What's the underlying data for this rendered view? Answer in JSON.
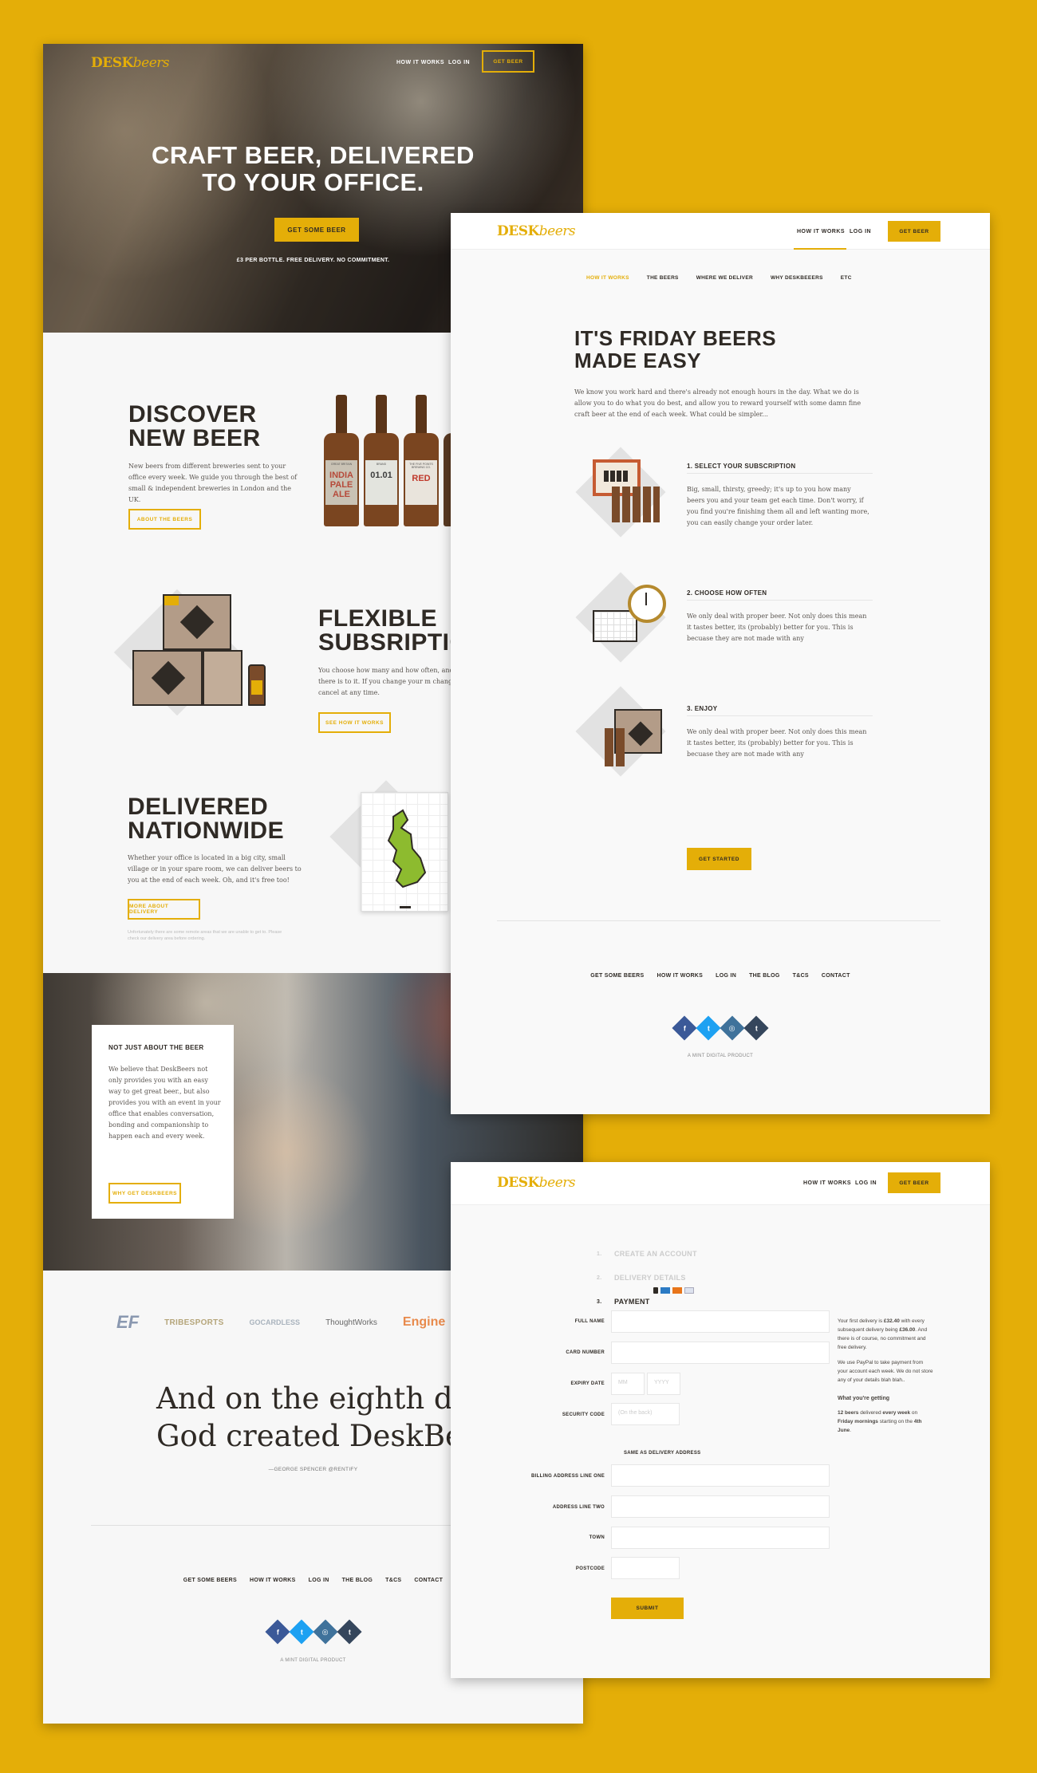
{
  "brand": {
    "logo_prefix": "DESK",
    "logo_suffix": "beers",
    "accent": "#e4ae08",
    "dark": "#2f2a25"
  },
  "landing": {
    "nav": {
      "how": "HOW IT WORKS",
      "login": "LOG IN",
      "cta": "GET BEER"
    },
    "hero": {
      "title_line1": "CRAFT BEER, DELIVERED",
      "title_line2": "TO YOUR OFFICE.",
      "cta": "GET SOME BEER",
      "note": "£3 PER BOTTLE. FREE DELIVERY. NO COMMITMENT."
    },
    "discover": {
      "title_line1": "DISCOVER",
      "title_line2": "NEW BEER",
      "body": "New beers from different breweries sent to your office every week. We guide you through the best of small & independent breweries in London and the UK.",
      "cta": "ABOUT THE BEERS"
    },
    "bottles": [
      {
        "label": "INDIA PALE ALE",
        "brand": "GREAT BRITAIN",
        "color": "#c9c2b4",
        "text": "#b64a3a"
      },
      {
        "label": "01.01",
        "brand": "BRAND",
        "color": "#e3e4de",
        "text": "#3d3d3d"
      },
      {
        "label": "RED",
        "brand": "THE FIVE POINTS BREWING CO.",
        "color": "#e9e4dc",
        "text": "#c0392b"
      }
    ],
    "flexible": {
      "title_line1": "FLEXIBLE",
      "title_line2": "SUBSRIPTIO",
      "body": "You choose how many and how often, and much all there is to it. If you change your m change, pause or cancel at any time.",
      "cta": "SEE HOW IT WORKS"
    },
    "delivered": {
      "title_line1": "DELIVERED",
      "title_line2": "NATIONWIDE",
      "body": "Whether your office is located in a big city, small village or in your spare room, we can deliver beers to you at the end of each week. Oh, and it's free too!",
      "cta": "MORE ABOUT DELIVERY",
      "fine": "Unfortunately there are some remote areas that we are unable to get to. Please check our delivery area before ordering."
    },
    "about": {
      "title": "NOT JUST ABOUT THE BEER",
      "body": "We believe that DeskBeers not only provides you with an easy way to get great beer., but also provides you with an event in your office that enables conversation, bonding and companionship to happen each and every week.",
      "cta": "WHY GET DESKBEERS"
    },
    "logos": [
      "EF",
      "TRIBESPORTS",
      "GOCARDLESS",
      "ThoughtWorks",
      "Engine"
    ],
    "quote": {
      "line1": "And on the eighth day",
      "line2": "God created DeskBeer",
      "author": "—GEORGE SPENCER @RENTIFY"
    },
    "footer": {
      "links": [
        "GET SOME BEERS",
        "HOW IT WORKS",
        "LOG IN",
        "THE BLOG",
        "T&CS",
        "CONTACT"
      ],
      "credit": "A MINT DIGITAL PRODUCT"
    }
  },
  "how": {
    "nav": {
      "how": "HOW IT WORKS",
      "login": "LOG IN",
      "cta": "GET BEER"
    },
    "tabs": [
      "HOW IT WORKS",
      "THE BEERS",
      "WHERE WE DELIVER",
      "WHY DESKBEEERS",
      "ETC"
    ],
    "title_line1": "IT'S FRIDAY BEERS",
    "title_line2": "MADE EASY",
    "intro": "We know you work hard and there's already not enough hours in the day. What we do is allow you to do what you do best, and allow you to reward yourself with some damn fine craft beer at the end of each week. What could be simpler...",
    "steps": [
      {
        "title": "1. SELECT YOUR SUBSCRIPTION",
        "body": "Big, small, thirsty, greedy; it's up to you how many beers you and your team get each time. Don't worry, if you find you're finishing them all and left wanting more, you can easily change your order later."
      },
      {
        "title": "2. CHOOSE HOW OFTEN",
        "body": "We only deal with proper beer. Not only does this mean it tastes better, its (probably) better for you. This is becuase they are not made with any"
      },
      {
        "title": "3. ENJOY",
        "body": "We only deal with proper beer. Not only does this mean it tastes better, its (probably) better for you. This is becuase they are not made with any"
      }
    ],
    "cta": "GET STARTED",
    "footer": {
      "links": [
        "GET SOME BEERS",
        "HOW IT WORKS",
        "LOG IN",
        "THE BLOG",
        "T&CS",
        "CONTACT"
      ],
      "credit": "A MINT DIGITAL PRODUCT"
    }
  },
  "checkout": {
    "nav": {
      "how": "HOW IT WORKS",
      "login": "LOG IN",
      "cta": "GET BEER"
    },
    "steps": [
      {
        "num": "1.",
        "label": "CREATE AN ACCOUNT"
      },
      {
        "num": "2.",
        "label": "DELIVERY DETAILS"
      },
      {
        "num": "3.",
        "label": "PAYMENT"
      }
    ],
    "fields": {
      "full_name": "FULL NAME",
      "card_number": "CARD NUMBER",
      "expiry": "EXPIRY DATE",
      "mm": "MM",
      "yyyy": "YYYY",
      "security": "SECURITY CODE",
      "security_ph": "(On the back)",
      "same_addr": "SAME AS DELIVERY ADDRESS",
      "billing1": "BILLING ADDRESS LINE ONE",
      "line2": "ADDRESS LINE TWO",
      "town": "TOWN",
      "postcode": "POSTCODE",
      "submit": "SUBMIT"
    },
    "side": {
      "p1_a": "Your first delivery is ",
      "p1_b": "£32.40",
      "p1_c": " with every subsequent delivery being ",
      "p1_d": "£36.00",
      "p1_e": ". And there is of course, no commitment and free delivery.",
      "p2": "We use PayPal to take payment from your account each week. We do not store any of your details blah blah..",
      "heading": "What you're getting",
      "g_a": "12 beers",
      "g_b": " delivered ",
      "g_c": "every week",
      "g_d": " on ",
      "g_e": "Friday mornings",
      "g_f": " starting on the ",
      "g_g": "4th June",
      "g_h": "."
    }
  }
}
